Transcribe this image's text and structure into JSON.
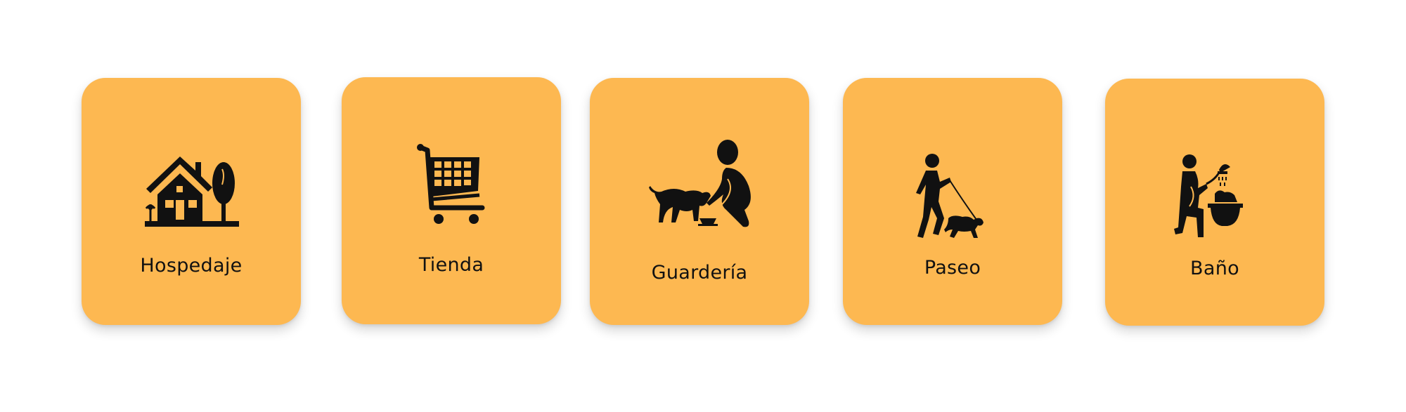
{
  "services": [
    {
      "label": "Hospedaje",
      "icon": "house-icon"
    },
    {
      "label": "Tienda",
      "icon": "shopping-cart-icon"
    },
    {
      "label": "Guardería",
      "icon": "person-feeding-dog-icon"
    },
    {
      "label": "Paseo",
      "icon": "person-walking-dog-icon"
    },
    {
      "label": "Baño",
      "icon": "dog-bath-icon"
    }
  ],
  "colors": {
    "card_background": "#fdb851",
    "icon": "#111111",
    "text": "#111111"
  }
}
